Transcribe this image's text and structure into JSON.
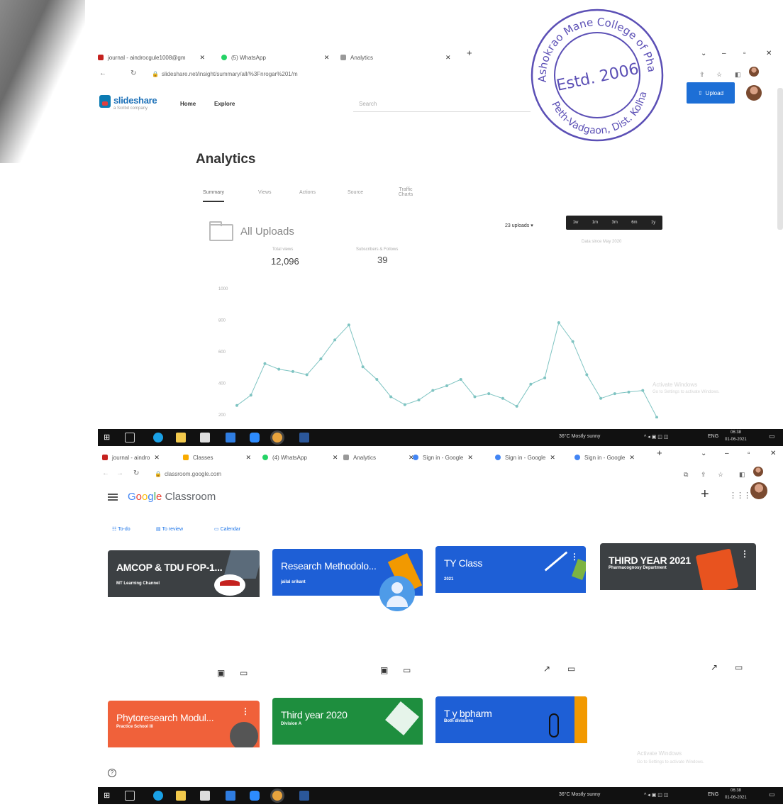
{
  "stamp": {
    "top_text": "Ashokrao Mane College of Pharmacy",
    "center_text": "Estd. 2006",
    "bottom_text": "Peth-Vadgaon, Dist. Kolhapur",
    "color": "#5b4fb5"
  },
  "screen1": {
    "tabs": [
      {
        "label": "journal - aindrocgule1008@gm",
        "fav_color": "#c5221f"
      },
      {
        "label": "(5) WhatsApp",
        "fav_color": "#25d366"
      },
      {
        "label": "Analytics",
        "fav_color": "#999999"
      }
    ],
    "address": "slideshare.net/insight/summary/all/%3Fnrogar%201/m",
    "slideshare": {
      "logo": "slideshare",
      "logo_sub": "a Scribd company",
      "nav": [
        "Home",
        "Explore"
      ],
      "search_placeholder": "Search",
      "upload_label": "Upload"
    },
    "page_title": "Analytics",
    "tabs_analytics": [
      "Summary",
      "Views",
      "Actions",
      "Source",
      "Traffic Charts"
    ],
    "uploads_title": "All Uploads",
    "uploads_dropdown": "23 uploads ▾",
    "ranges": [
      "1w",
      "1m",
      "3m",
      "6m",
      "1y"
    ],
    "range_note": "Data since May 2020",
    "stats": [
      {
        "label": "Total views",
        "value": "12,096"
      },
      {
        "label": "Subscribers & Follows",
        "value": "39"
      }
    ],
    "watermark": [
      "Activate Windows",
      "Go to Settings to activate Windows."
    ]
  },
  "chart_data": {
    "type": "line",
    "title": "",
    "xlabel": "",
    "ylabel": "",
    "ylim": [
      200,
      1000
    ],
    "yticks": [
      "1000",
      "800",
      "600",
      "400",
      "200"
    ],
    "series": [
      {
        "values": [
          255,
          320,
          520,
          485,
          470,
          450,
          550,
          670,
          765,
          500,
          420,
          310,
          260,
          290,
          350,
          380,
          420,
          310,
          330,
          300,
          250,
          390,
          430,
          780,
          660,
          450,
          300,
          330,
          340,
          350,
          180
        ]
      }
    ],
    "color": "#7fc4c2",
    "grid": false
  },
  "taskbar": {
    "weather": "36°C Mostly sunny",
    "lang": "ENG",
    "time": "06:38",
    "date": "01-06-2021"
  },
  "screen2": {
    "tabs": [
      {
        "label": "journal - aindro",
        "fav_color": "#c5221f"
      },
      {
        "label": "Classes",
        "fav_color": "#f9ab00"
      },
      {
        "label": "(4) WhatsApp",
        "fav_color": "#25d366"
      },
      {
        "label": "Analytics",
        "fav_color": "#999999"
      },
      {
        "label": "Sign in - Google",
        "fav_color": "#4285f4"
      },
      {
        "label": "Sign in - Google",
        "fav_color": "#4285f4"
      },
      {
        "label": "Sign in - Google",
        "fav_color": "#4285f4"
      }
    ],
    "address": "classroom.google.com",
    "brand_rest": "Classroom",
    "links": [
      "To-do",
      "To review",
      "Calendar"
    ],
    "classes": [
      {
        "title": "AMCOP & TDU FOP-1...",
        "subtitle": "MT Learning Channel",
        "color": "#3c4043"
      },
      {
        "title": "Research Methodolo...",
        "subtitle": "jailal srikant",
        "color": "#1e5fd6"
      },
      {
        "title": "TY Class",
        "subtitle": "2021",
        "color": "#1e5fd6"
      },
      {
        "title": "THIRD YEAR 2021",
        "subtitle": "Pharmacognosy Department",
        "color": "#3c4043"
      },
      {
        "title": "Phytoresearch Modul...",
        "subtitle": "Practice School III",
        "color": "#f0613a"
      },
      {
        "title": "Third year 2020",
        "subtitle": "Division A",
        "color": "#1e8e3e"
      },
      {
        "title": "T y bpharm",
        "subtitle": "Both divisions",
        "color": "#1e5fd6"
      }
    ],
    "watermark": [
      "Activate Windows",
      "Go to Settings to activate Windows."
    ]
  }
}
